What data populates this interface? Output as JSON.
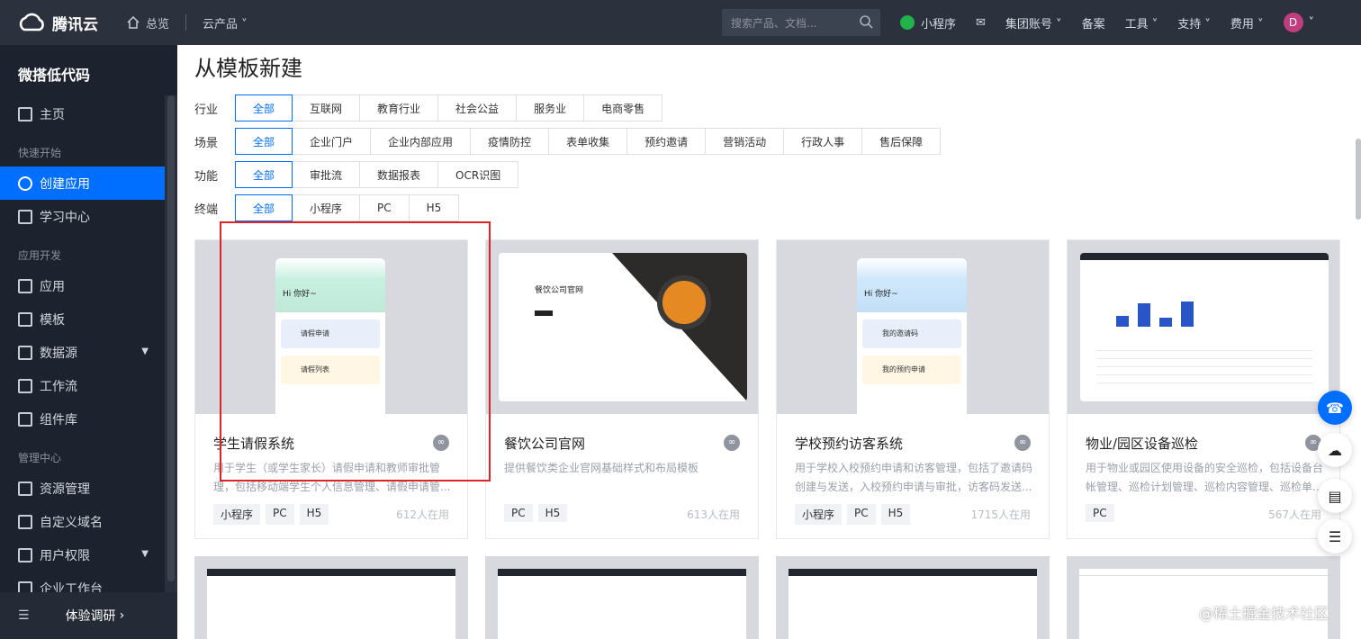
{
  "topbar": {
    "brand": "腾讯云",
    "home": "总览",
    "products": "云产品 ˅",
    "search_placeholder": "搜索产品、文档...",
    "right_items": [
      "小程序",
      "集团账号 ˅",
      "备案",
      "工具 ˅",
      "支持 ˅",
      "费用 ˅"
    ],
    "avatar_letter": "D"
  },
  "sidebar": {
    "title": "微搭低代码",
    "home": "主页",
    "group_quick": "快速开始",
    "create_app": "创建应用",
    "learning": "学习中心",
    "group_dev": "应用开发",
    "apps": "应用",
    "templates": "模板",
    "datasource": "数据源",
    "workflow": "工作流",
    "components": "组件库",
    "group_admin": "管理中心",
    "resources": "资源管理",
    "domain": "自定义域名",
    "permissions": "用户权限",
    "workbench": "企业工作台",
    "survey": "体验调研"
  },
  "main": {
    "title": "从模板新建",
    "filters": [
      {
        "label": "行业",
        "options": [
          "全部",
          "互联网",
          "教育行业",
          "社会公益",
          "服务业",
          "电商零售"
        ]
      },
      {
        "label": "场景",
        "options": [
          "全部",
          "企业门户",
          "企业内部应用",
          "疫情防控",
          "表单收集",
          "预约邀请",
          "营销活动",
          "行政人事",
          "售后保障"
        ]
      },
      {
        "label": "功能",
        "options": [
          "全部",
          "审批流",
          "数据报表",
          "OCR识图"
        ]
      },
      {
        "label": "终端",
        "options": [
          "全部",
          "小程序",
          "PC",
          "H5"
        ]
      }
    ],
    "cards": [
      {
        "name": "学生请假系统",
        "desc": "用于学生（或学生家长）请假申请和教师审批管理，包括移动端学生个人信息管理、请假申请管...",
        "tags": [
          "小程序",
          "PC",
          "H5"
        ],
        "users": "612人在用",
        "thumb_title": "学生请假系统",
        "hello": "Hi 你好~",
        "item1": "请假申请",
        "item2": "请假列表"
      },
      {
        "name": "餐饮公司官网",
        "desc": "提供餐饮类企业官网基础样式和布局模板",
        "tags": [
          "PC",
          "H5"
        ],
        "users": "613人在用",
        "thumb_title": "餐饮公司官网"
      },
      {
        "name": "学校预约访客系统",
        "desc": "用于学校入校预约申请和访客管理，包括了邀请码创建与发送，入校预约申请与审批，访客码发送...",
        "tags": [
          "小程序",
          "PC",
          "H5"
        ],
        "users": "1715人在用",
        "thumb_title": "学校预约访客系统",
        "hello": "Hi 你好~",
        "item1": "我的邀请码",
        "item2": "我的预约申请"
      },
      {
        "name": "物业/园区设备巡检",
        "desc": "用于物业或园区使用设备的安全巡检，包括设备台帐管理、巡检计划管理、巡检内容管理、巡检单...",
        "tags": [
          "PC"
        ],
        "users": "567人在用"
      }
    ],
    "watermark": "@稀土掘金技术社区"
  },
  "colors": {
    "accent": "#006eff",
    "topbar": "#2b313d",
    "sidebar": "#1d232e",
    "highlight_box": "#e02424"
  }
}
